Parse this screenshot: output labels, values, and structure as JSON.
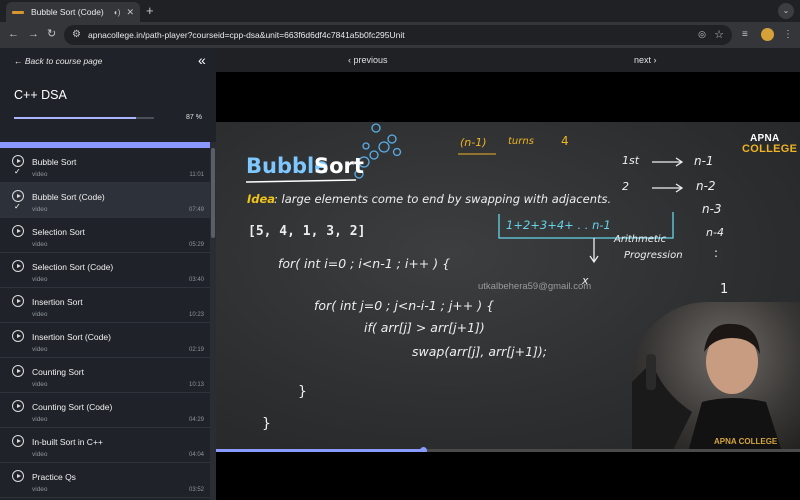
{
  "browser": {
    "tab_title": "Bubble Sort (Code)",
    "tab_close": "✕",
    "new_tab": "+",
    "url": "apnacollege.in/path-player?courseid=cpp-dsa&unit=663f6d6df4c7841a5b0fc295Unit"
  },
  "sidebar": {
    "back_label": "← Back to course page",
    "collapse": "«",
    "course_title": "C++ DSA",
    "progress": {
      "value": 87,
      "label": "87 %"
    },
    "lessons": [
      {
        "name": "Bubble Sort",
        "type": "video",
        "duration": "11:01",
        "completed": true,
        "active": false
      },
      {
        "name": "Bubble Sort (Code)",
        "type": "video",
        "duration": "07:49",
        "completed": true,
        "active": true
      },
      {
        "name": "Selection Sort",
        "type": "video",
        "duration": "05:29",
        "completed": false,
        "active": false
      },
      {
        "name": "Selection Sort (Code)",
        "type": "video",
        "duration": "03:40",
        "completed": false,
        "active": false
      },
      {
        "name": "Insertion Sort",
        "type": "video",
        "duration": "10:23",
        "completed": false,
        "active": false
      },
      {
        "name": "Insertion Sort (Code)",
        "type": "video",
        "duration": "02:19",
        "completed": false,
        "active": false
      },
      {
        "name": "Counting Sort",
        "type": "video",
        "duration": "10:13",
        "completed": false,
        "active": false
      },
      {
        "name": "Counting Sort (Code)",
        "type": "video",
        "duration": "04:29",
        "completed": false,
        "active": false
      },
      {
        "name": "In-built Sort in C++",
        "type": "video",
        "duration": "04:04",
        "completed": false,
        "active": false
      },
      {
        "name": "Practice Qs",
        "type": "video",
        "duration": "03:52",
        "completed": false,
        "active": false
      }
    ]
  },
  "player_nav": {
    "previous": "‹ previous",
    "next": "next ›"
  },
  "video": {
    "logo_line1": "APNA",
    "logo_line2": "COLLEGE",
    "watermark": "utkalbehera59@gmail.com",
    "board": {
      "heading_part1": "Bubble",
      "heading_part2": "Sort",
      "idea_label": "Idea",
      "idea_text": ": large elements come to end by swapping with adjacents.",
      "array": "[5, 4, 1, 3, 2]",
      "note_n1": "(n-1)",
      "note_turns": "turns",
      "note_4": "4",
      "pass_1st": "1st",
      "pass_2": "2",
      "rhs": [
        "n-1",
        "n-2",
        "n-3",
        "n-4",
        ":",
        "1"
      ],
      "series": "1+2+3+4+ . . n-1",
      "ap_line1": "Arithmetic",
      "ap_line2": "Progression",
      "x_mark": "x",
      "code_outer": "for( int i=0 ; i<n-1 ; i++ ) {",
      "code_inner": "for( int j=0 ; j<n-i-1 ; j++ ) {",
      "code_if": "if( arr[j] > arr[j+1])",
      "code_swap": "swap(arr[j], arr[j+1]);",
      "brace1": "}",
      "brace2": "}"
    },
    "seek": {
      "played": 0.355
    }
  },
  "colors": {
    "accent": "#8a97ff",
    "sidebar_bg": "#1f2329",
    "logo_accent": "#f0b323",
    "heading_blue": "#7ec8ff",
    "idea_yellow": "#f0c419"
  }
}
